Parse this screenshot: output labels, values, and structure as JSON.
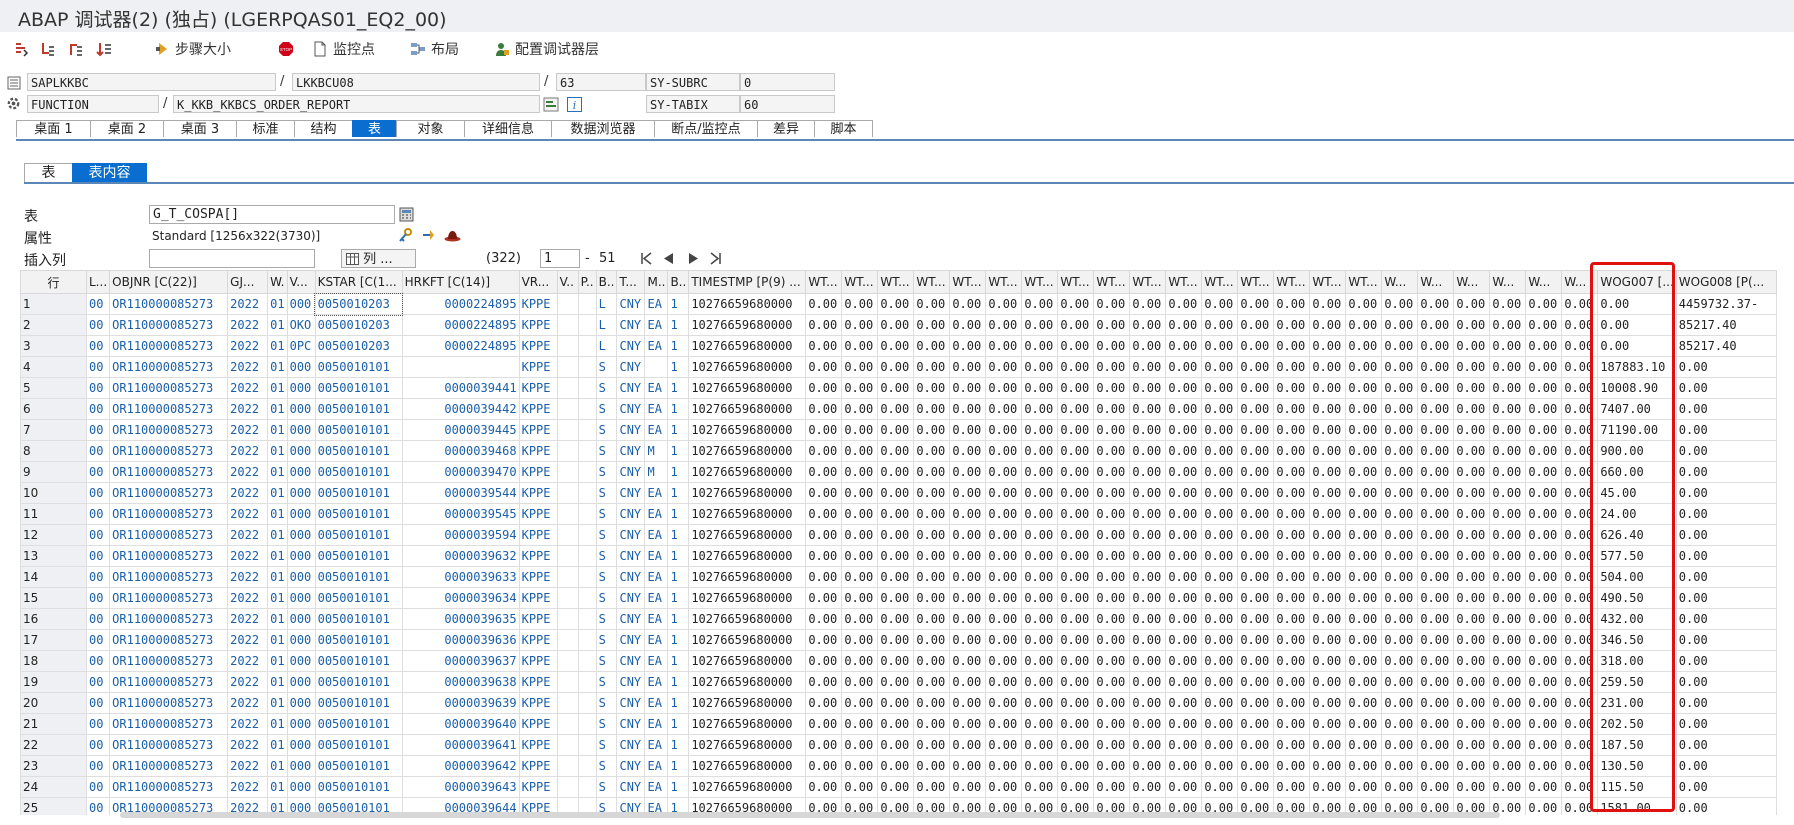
{
  "window": {
    "title": "ABAP 调试器(2)  (独占) (LGERPQAS01_EQ2_00)"
  },
  "toolbar": {
    "step_size": "步骤大小",
    "watchpoint": "监控点",
    "layout": "布局",
    "config_layers": "配置调试器层",
    "icons": [
      "step-into-icon",
      "step-over-icon",
      "return-icon",
      "continue-icon",
      "step-size-icon",
      "stop-icon",
      "watchpoint-icon",
      "layout-icon",
      "config-icon"
    ]
  },
  "info": {
    "program": "SAPLKKBC",
    "include": "LKKBCU08",
    "line": "63",
    "subrc_label": "SY-SUBRC",
    "subrc_value": "0",
    "event_type": "FUNCTION",
    "event": "K_KKB_KKBCS_ORDER_REPORT",
    "tabix_label": "SY-TABIX",
    "tabix_value": "60",
    "slash": "/"
  },
  "main_tabs": [
    {
      "label": "桌面 1"
    },
    {
      "label": "桌面 2"
    },
    {
      "label": "桌面 3"
    },
    {
      "label": "标准"
    },
    {
      "label": "结构"
    },
    {
      "label": "表",
      "active": true
    },
    {
      "label": "对象"
    },
    {
      "label": "详细信息"
    },
    {
      "label": "数据浏览器"
    },
    {
      "label": "断点/监控点"
    },
    {
      "label": "差异"
    },
    {
      "label": "脚本"
    }
  ],
  "sub_tabs": [
    {
      "label": "表"
    },
    {
      "label": "表内容",
      "active": true
    }
  ],
  "table_info": {
    "table_label": "表",
    "table_value": "G_T_COSPA[]",
    "attr_label": "属性",
    "attr_value": "Standard [1256x322(3730)]",
    "insert_col_label": "插入列",
    "col_button": "列 ...",
    "count": "(322)",
    "from": "1",
    "dash": "-",
    "to": "51"
  },
  "grid": {
    "columns": [
      "行",
      "L...",
      "OBJNR [C(22)]",
      "GJ...",
      "W.",
      "V...",
      "KSTAR [C(1...",
      "HRKFT [C(14)]",
      "VR...",
      "V..",
      "P..",
      "B..",
      "T...",
      "M..",
      "B..",
      "TIMESTMP [P(9) ...",
      "WT...",
      "WT...",
      "WT...",
      "WT...",
      "WT...",
      "WT...",
      "WT...",
      "WT...",
      "WT...",
      "WT...",
      "WT...",
      "WT...",
      "WT...",
      "WT...",
      "WT...",
      "WT...",
      "W...",
      "W...",
      "W...",
      "W...",
      "W...",
      "W...",
      "WOG007 [...",
      "WOG008 [P(..."
    ],
    "highlight_color": "#e01010",
    "rows": [
      {
        "n": "1",
        "l": "00",
        "objnr": "OR110000085273",
        "gj": "2022",
        "w": "01",
        "v": "000",
        "kstar": "0050010203",
        "hrkft": "0000224895",
        "vr": "KPPE",
        "b": "L",
        "t": "CNY",
        "m": "EA",
        "b2": "1",
        "ts": "10276659680000",
        "wog7": "0.00",
        "wog8": "4459732.37-"
      },
      {
        "n": "2",
        "l": "00",
        "objnr": "OR110000085273",
        "gj": "2022",
        "w": "01",
        "v": "OKO",
        "kstar": "0050010203",
        "hrkft": "0000224895",
        "vr": "KPPE",
        "b": "L",
        "t": "CNY",
        "m": "EA",
        "b2": "1",
        "ts": "10276659680000",
        "wog7": "0.00",
        "wog8": "85217.40"
      },
      {
        "n": "3",
        "l": "00",
        "objnr": "OR110000085273",
        "gj": "2022",
        "w": "01",
        "v": "0PC",
        "kstar": "0050010203",
        "hrkft": "0000224895",
        "vr": "KPPE",
        "b": "L",
        "t": "CNY",
        "m": "EA",
        "b2": "1",
        "ts": "10276659680000",
        "wog7": "0.00",
        "wog8": "85217.40"
      },
      {
        "n": "4",
        "l": "00",
        "objnr": "OR110000085273",
        "gj": "2022",
        "w": "01",
        "v": "000",
        "kstar": "0050010101",
        "hrkft": "",
        "vr": "KPPE",
        "b": "S",
        "t": "CNY",
        "m": "",
        "b2": "1",
        "ts": "10276659680000",
        "wog7": "187883.10",
        "wog8": "0.00"
      },
      {
        "n": "5",
        "l": "00",
        "objnr": "OR110000085273",
        "gj": "2022",
        "w": "01",
        "v": "000",
        "kstar": "0050010101",
        "hrkft": "0000039441",
        "vr": "KPPE",
        "b": "S",
        "t": "CNY",
        "m": "EA",
        "b2": "1",
        "ts": "10276659680000",
        "wog7": "10008.90",
        "wog8": "0.00"
      },
      {
        "n": "6",
        "l": "00",
        "objnr": "OR110000085273",
        "gj": "2022",
        "w": "01",
        "v": "000",
        "kstar": "0050010101",
        "hrkft": "0000039442",
        "vr": "KPPE",
        "b": "S",
        "t": "CNY",
        "m": "EA",
        "b2": "1",
        "ts": "10276659680000",
        "wog7": "7407.00",
        "wog8": "0.00"
      },
      {
        "n": "7",
        "l": "00",
        "objnr": "OR110000085273",
        "gj": "2022",
        "w": "01",
        "v": "000",
        "kstar": "0050010101",
        "hrkft": "0000039445",
        "vr": "KPPE",
        "b": "S",
        "t": "CNY",
        "m": "EA",
        "b2": "1",
        "ts": "10276659680000",
        "wog7": "71190.00",
        "wog8": "0.00"
      },
      {
        "n": "8",
        "l": "00",
        "objnr": "OR110000085273",
        "gj": "2022",
        "w": "01",
        "v": "000",
        "kstar": "0050010101",
        "hrkft": "0000039468",
        "vr": "KPPE",
        "b": "S",
        "t": "CNY",
        "m": "M",
        "b2": "1",
        "ts": "10276659680000",
        "wog7": "900.00",
        "wog8": "0.00"
      },
      {
        "n": "9",
        "l": "00",
        "objnr": "OR110000085273",
        "gj": "2022",
        "w": "01",
        "v": "000",
        "kstar": "0050010101",
        "hrkft": "0000039470",
        "vr": "KPPE",
        "b": "S",
        "t": "CNY",
        "m": "M",
        "b2": "1",
        "ts": "10276659680000",
        "wog7": "660.00",
        "wog8": "0.00"
      },
      {
        "n": "10",
        "l": "00",
        "objnr": "OR110000085273",
        "gj": "2022",
        "w": "01",
        "v": "000",
        "kstar": "0050010101",
        "hrkft": "0000039544",
        "vr": "KPPE",
        "b": "S",
        "t": "CNY",
        "m": "EA",
        "b2": "1",
        "ts": "10276659680000",
        "wog7": "45.00",
        "wog8": "0.00"
      },
      {
        "n": "11",
        "l": "00",
        "objnr": "OR110000085273",
        "gj": "2022",
        "w": "01",
        "v": "000",
        "kstar": "0050010101",
        "hrkft": "0000039545",
        "vr": "KPPE",
        "b": "S",
        "t": "CNY",
        "m": "EA",
        "b2": "1",
        "ts": "10276659680000",
        "wog7": "24.00",
        "wog8": "0.00"
      },
      {
        "n": "12",
        "l": "00",
        "objnr": "OR110000085273",
        "gj": "2022",
        "w": "01",
        "v": "000",
        "kstar": "0050010101",
        "hrkft": "0000039594",
        "vr": "KPPE",
        "b": "S",
        "t": "CNY",
        "m": "EA",
        "b2": "1",
        "ts": "10276659680000",
        "wog7": "626.40",
        "wog8": "0.00"
      },
      {
        "n": "13",
        "l": "00",
        "objnr": "OR110000085273",
        "gj": "2022",
        "w": "01",
        "v": "000",
        "kstar": "0050010101",
        "hrkft": "0000039632",
        "vr": "KPPE",
        "b": "S",
        "t": "CNY",
        "m": "EA",
        "b2": "1",
        "ts": "10276659680000",
        "wog7": "577.50",
        "wog8": "0.00"
      },
      {
        "n": "14",
        "l": "00",
        "objnr": "OR110000085273",
        "gj": "2022",
        "w": "01",
        "v": "000",
        "kstar": "0050010101",
        "hrkft": "0000039633",
        "vr": "KPPE",
        "b": "S",
        "t": "CNY",
        "m": "EA",
        "b2": "1",
        "ts": "10276659680000",
        "wog7": "504.00",
        "wog8": "0.00"
      },
      {
        "n": "15",
        "l": "00",
        "objnr": "OR110000085273",
        "gj": "2022",
        "w": "01",
        "v": "000",
        "kstar": "0050010101",
        "hrkft": "0000039634",
        "vr": "KPPE",
        "b": "S",
        "t": "CNY",
        "m": "EA",
        "b2": "1",
        "ts": "10276659680000",
        "wog7": "490.50",
        "wog8": "0.00"
      },
      {
        "n": "16",
        "l": "00",
        "objnr": "OR110000085273",
        "gj": "2022",
        "w": "01",
        "v": "000",
        "kstar": "0050010101",
        "hrkft": "0000039635",
        "vr": "KPPE",
        "b": "S",
        "t": "CNY",
        "m": "EA",
        "b2": "1",
        "ts": "10276659680000",
        "wog7": "432.00",
        "wog8": "0.00"
      },
      {
        "n": "17",
        "l": "00",
        "objnr": "OR110000085273",
        "gj": "2022",
        "w": "01",
        "v": "000",
        "kstar": "0050010101",
        "hrkft": "0000039636",
        "vr": "KPPE",
        "b": "S",
        "t": "CNY",
        "m": "EA",
        "b2": "1",
        "ts": "10276659680000",
        "wog7": "346.50",
        "wog8": "0.00"
      },
      {
        "n": "18",
        "l": "00",
        "objnr": "OR110000085273",
        "gj": "2022",
        "w": "01",
        "v": "000",
        "kstar": "0050010101",
        "hrkft": "0000039637",
        "vr": "KPPE",
        "b": "S",
        "t": "CNY",
        "m": "EA",
        "b2": "1",
        "ts": "10276659680000",
        "wog7": "318.00",
        "wog8": "0.00"
      },
      {
        "n": "19",
        "l": "00",
        "objnr": "OR110000085273",
        "gj": "2022",
        "w": "01",
        "v": "000",
        "kstar": "0050010101",
        "hrkft": "0000039638",
        "vr": "KPPE",
        "b": "S",
        "t": "CNY",
        "m": "EA",
        "b2": "1",
        "ts": "10276659680000",
        "wog7": "259.50",
        "wog8": "0.00"
      },
      {
        "n": "20",
        "l": "00",
        "objnr": "OR110000085273",
        "gj": "2022",
        "w": "01",
        "v": "000",
        "kstar": "0050010101",
        "hrkft": "0000039639",
        "vr": "KPPE",
        "b": "S",
        "t": "CNY",
        "m": "EA",
        "b2": "1",
        "ts": "10276659680000",
        "wog7": "231.00",
        "wog8": "0.00"
      },
      {
        "n": "21",
        "l": "00",
        "objnr": "OR110000085273",
        "gj": "2022",
        "w": "01",
        "v": "000",
        "kstar": "0050010101",
        "hrkft": "0000039640",
        "vr": "KPPE",
        "b": "S",
        "t": "CNY",
        "m": "EA",
        "b2": "1",
        "ts": "10276659680000",
        "wog7": "202.50",
        "wog8": "0.00"
      },
      {
        "n": "22",
        "l": "00",
        "objnr": "OR110000085273",
        "gj": "2022",
        "w": "01",
        "v": "000",
        "kstar": "0050010101",
        "hrkft": "0000039641",
        "vr": "KPPE",
        "b": "S",
        "t": "CNY",
        "m": "EA",
        "b2": "1",
        "ts": "10276659680000",
        "wog7": "187.50",
        "wog8": "0.00"
      },
      {
        "n": "23",
        "l": "00",
        "objnr": "OR110000085273",
        "gj": "2022",
        "w": "01",
        "v": "000",
        "kstar": "0050010101",
        "hrkft": "0000039642",
        "vr": "KPPE",
        "b": "S",
        "t": "CNY",
        "m": "EA",
        "b2": "1",
        "ts": "10276659680000",
        "wog7": "130.50",
        "wog8": "0.00"
      },
      {
        "n": "24",
        "l": "00",
        "objnr": "OR110000085273",
        "gj": "2022",
        "w": "01",
        "v": "000",
        "kstar": "0050010101",
        "hrkft": "0000039643",
        "vr": "KPPE",
        "b": "S",
        "t": "CNY",
        "m": "EA",
        "b2": "1",
        "ts": "10276659680000",
        "wog7": "115.50",
        "wog8": "0.00"
      },
      {
        "n": "25",
        "l": "00",
        "objnr": "OR110000085273",
        "gj": "2022",
        "w": "01",
        "v": "000",
        "kstar": "0050010101",
        "hrkft": "0000039644",
        "vr": "KPPE",
        "b": "S",
        "t": "CNY",
        "m": "EA",
        "b2": "1",
        "ts": "10276659680000",
        "wog7": "1581.00",
        "wog8": "0.00"
      }
    ],
    "zero_value": "0.00"
  }
}
